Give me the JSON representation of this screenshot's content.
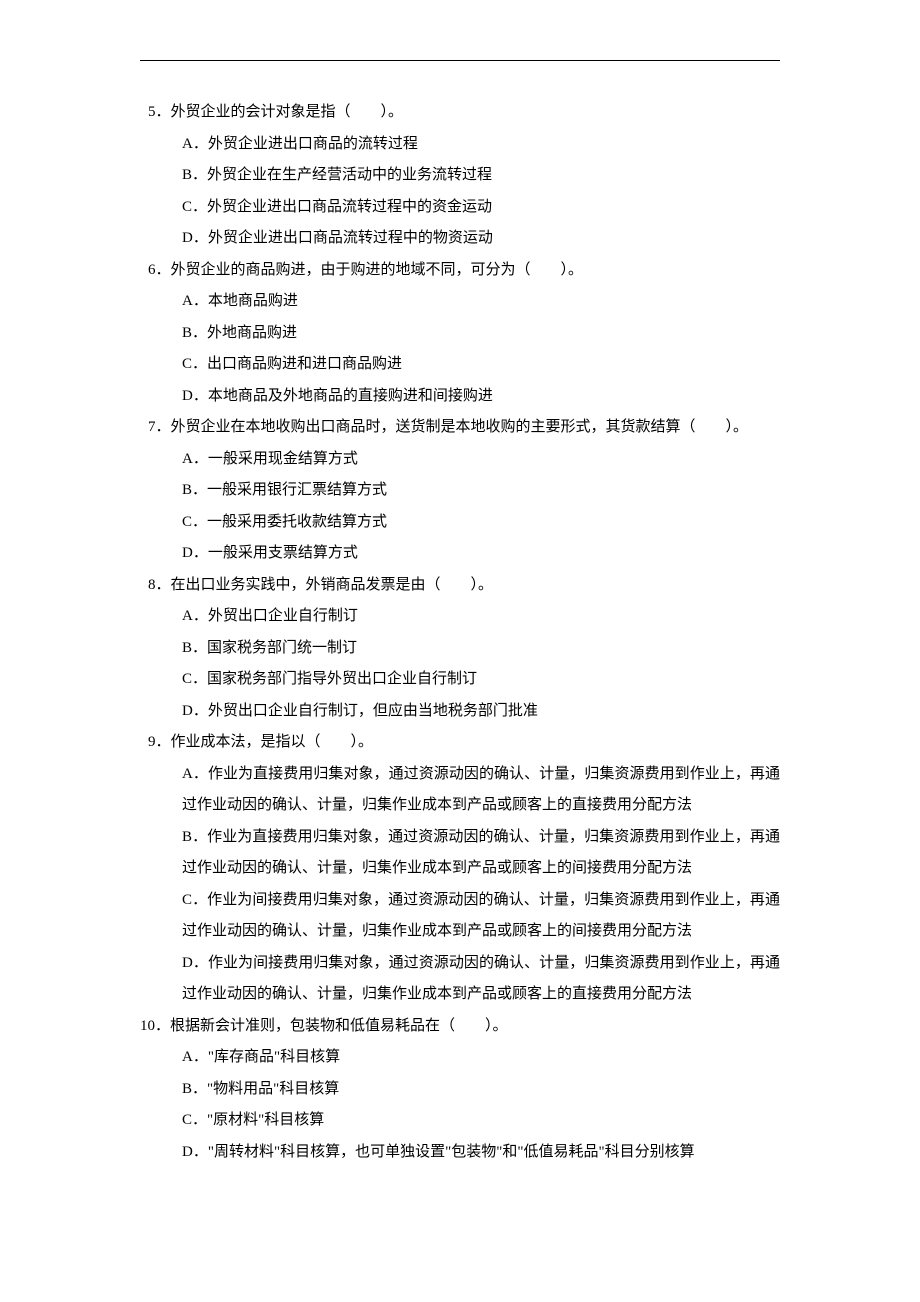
{
  "questions": [
    {
      "number": "5",
      "stem": "．外贸企业的会计对象是指（　　）。",
      "options": [
        "A．外贸企业进出口商品的流转过程",
        "B．外贸企业在生产经营活动中的业务流转过程",
        "C．外贸企业进出口商品流转过程中的资金运动",
        "D．外贸企业进出口商品流转过程中的物资运动"
      ]
    },
    {
      "number": "6",
      "stem": "．外贸企业的商品购进，由于购进的地域不同，可分为（　　）。",
      "options": [
        "A．本地商品购进",
        "B．外地商品购进",
        "C．出口商品购进和进口商品购进",
        "D．本地商品及外地商品的直接购进和间接购进"
      ]
    },
    {
      "number": "7",
      "stem": "．外贸企业在本地收购出口商品时，送货制是本地收购的主要形式，其货款结算（　　）。",
      "options": [
        "A．一般采用现金结算方式",
        "B．一般采用银行汇票结算方式",
        "C．一般采用委托收款结算方式",
        "D．一般采用支票结算方式"
      ]
    },
    {
      "number": "8",
      "stem": "．在出口业务实践中，外销商品发票是由（　　）。",
      "options": [
        "A．外贸出口企业自行制订",
        "B．国家税务部门统一制订",
        "C．国家税务部门指导外贸出口企业自行制订",
        "D．外贸出口企业自行制订，但应由当地税务部门批准"
      ]
    },
    {
      "number": "9",
      "stem": "．作业成本法，是指以（　　）。",
      "options": [
        "A．作业为直接费用归集对象，通过资源动因的确认、计量，归集资源费用到作业上，再通过作业动因的确认、计量，归集作业成本到产品或顾客上的直接费用分配方法",
        "B．作业为直接费用归集对象，通过资源动因的确认、计量，归集资源费用到作业上，再通过作业动因的确认、计量，归集作业成本到产品或顾客上的间接费用分配方法",
        "C．作业为间接费用归集对象，通过资源动因的确认、计量，归集资源费用到作业上，再通过作业动因的确认、计量，归集作业成本到产品或顾客上的间接费用分配方法",
        "D．作业为间接费用归集对象，通过资源动因的确认、计量，归集资源费用到作业上，再通过作业动因的确认、计量，归集作业成本到产品或顾客上的直接费用分配方法"
      ]
    },
    {
      "number": "10",
      "stem": "．根据新会计准则，包装物和低值易耗品在（　　）。",
      "options": [
        "A．\"库存商品\"科目核算",
        "B．\"物料用品\"科目核算",
        "C．\"原材料\"科目核算",
        "D．\"周转材料\"科目核算，也可单独设置\"包装物\"和\"低值易耗品\"科目分别核算"
      ]
    }
  ]
}
